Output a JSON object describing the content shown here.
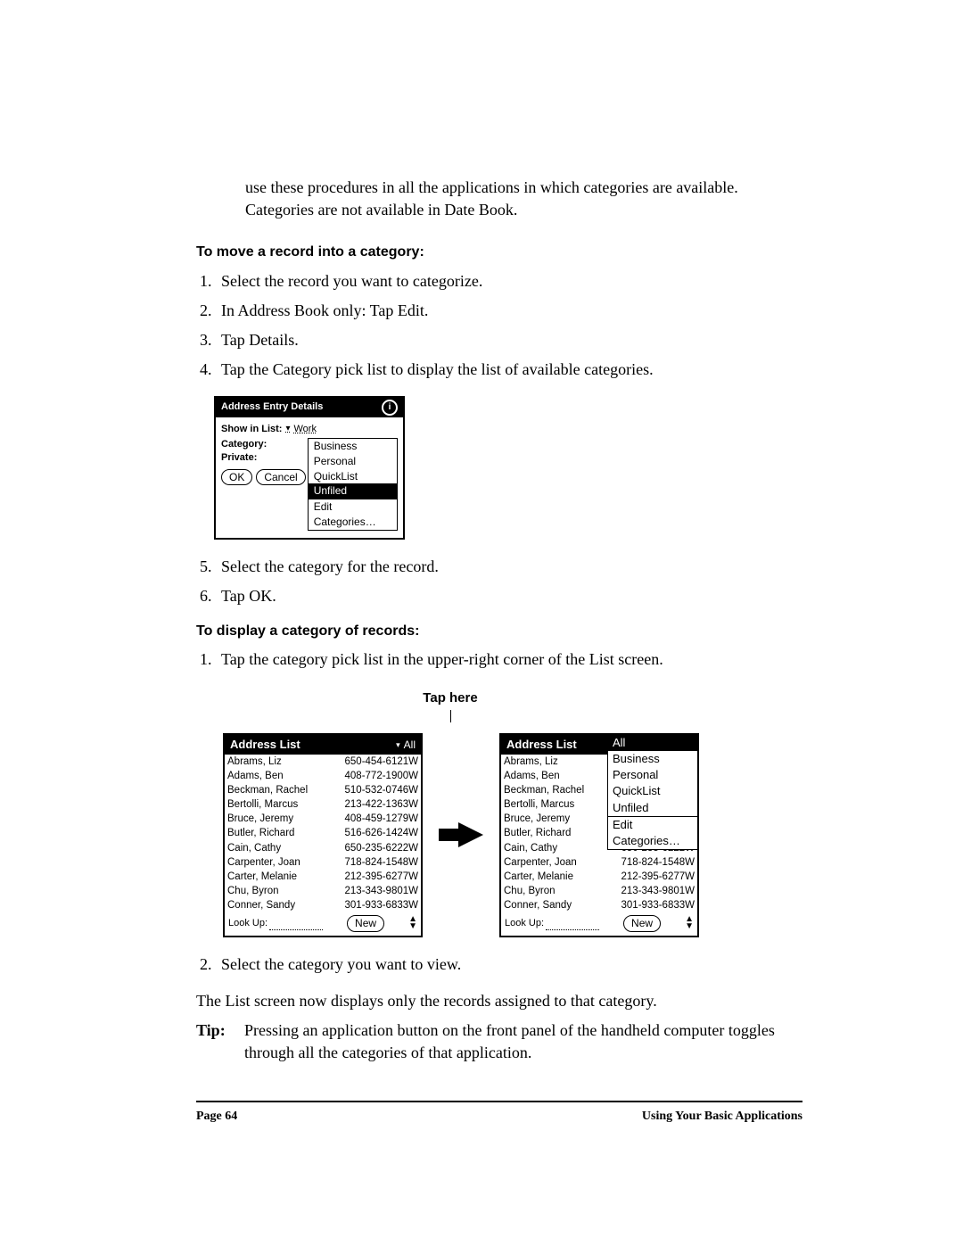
{
  "intro": "use these procedures in all the applications in which categories are available. Categories are not available in Date Book.",
  "section1": {
    "heading": "To move a record into a category:",
    "steps": [
      "Select the record you want to categorize.",
      "In Address Book only: Tap Edit.",
      "Tap Details.",
      "Tap the Category pick list to display the list of available categories.",
      "Select the category for the record.",
      "Tap OK."
    ]
  },
  "details_dialog": {
    "title": "Address Entry Details",
    "show_in_list_label": "Show in List:",
    "show_in_list_value": "Work",
    "category_label": "Category:",
    "private_label": "Private:",
    "ok": "OK",
    "cancel": "Cancel",
    "options": {
      "business": "Business",
      "personal": "Personal",
      "quicklist": "QuickList",
      "unfiled": "Unfiled",
      "edit": "Edit Categories…"
    }
  },
  "section2": {
    "heading": "To display a category of records:",
    "step1": "Tap the category pick list in the upper-right corner of the List screen.",
    "tap_here": "Tap here",
    "step2": "Select the category you want to view.",
    "result": "The List screen now displays only the records assigned to that category.",
    "tip_label": "Tip:",
    "tip_text": "Pressing an application button on the front panel of the handheld computer toggles through all the categories of that application."
  },
  "address_list": {
    "title": "Address List",
    "category_all": "All",
    "lookup": "Look Up:",
    "new": "New",
    "rows": [
      {
        "name": "Abrams, Liz",
        "num": "650-454-6121W"
      },
      {
        "name": "Adams, Ben",
        "num": "408-772-1900W"
      },
      {
        "name": "Beckman, Rachel",
        "num": "510-532-0746W"
      },
      {
        "name": "Bertolli, Marcus",
        "num": "213-422-1363W"
      },
      {
        "name": "Bruce, Jeremy",
        "num": "408-459-1279W"
      },
      {
        "name": "Butler, Richard",
        "num": "516-626-1424W"
      },
      {
        "name": "Cain, Cathy",
        "num": "650-235-6222W"
      },
      {
        "name": "Carpenter, Joan",
        "num": "718-824-1548W"
      },
      {
        "name": "Carter, Melanie",
        "num": "212-395-6277W"
      },
      {
        "name": "Chu, Byron",
        "num": "213-343-9801W"
      },
      {
        "name": "Conner, Sandy",
        "num": "301-933-6833W"
      }
    ]
  },
  "cat_menu": {
    "all": "All",
    "business": "Business",
    "personal": "Personal",
    "quicklist": "QuickList",
    "unfiled": "Unfiled",
    "edit": "Edit Categories…"
  },
  "footer": {
    "page": "Page 64",
    "chapter": "Using Your Basic Applications"
  }
}
